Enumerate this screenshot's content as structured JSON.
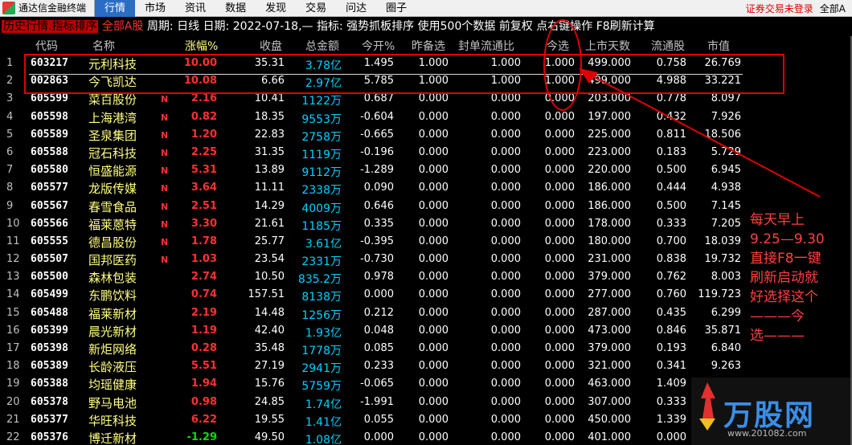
{
  "menubar": {
    "app_title": "通达信金融终端",
    "items": [
      "行情",
      "市场",
      "资讯",
      "数据",
      "发现",
      "交易",
      "问达",
      "圈子"
    ],
    "active": "行情",
    "right": [
      "证券交易未登录",
      "全部A"
    ]
  },
  "infobar": {
    "mode": "历史行情.指标排序",
    "scope": "全部A股",
    "period": "周期: 日线",
    "date": "日期: 2022-07-18,—",
    "indicator": "指标: 强势抓板排序",
    "usage": "使用500个数据",
    "fq": "前复权",
    "tip": "点右键操作",
    "refresh": "F8刷新计算"
  },
  "columns": [
    "代码",
    "名称",
    "涨幅%",
    "收盘",
    "总金额",
    "今开%",
    "昨备选",
    "封单流通比",
    "今选",
    "上市天数",
    "流通股",
    "市值"
  ],
  "rows": [
    {
      "idx": "1",
      "code": "603217",
      "name": "元利科技",
      "flag": "",
      "chg": "10.00",
      "dir": "up",
      "close": "35.31",
      "amt": "3.78亿",
      "open": "1.495",
      "prev": "1.000",
      "seal": "1.000",
      "today": "1.000",
      "days": "499.000",
      "float": "0.758",
      "mv": "26.769"
    },
    {
      "idx": "2",
      "code": "002863",
      "name": "今飞凯达",
      "flag": "",
      "chg": "10.08",
      "dir": "up",
      "close": "6.66",
      "amt": "2.97亿",
      "open": "5.785",
      "prev": "1.000",
      "seal": "1.000",
      "today": "1.000",
      "days": "499.000",
      "float": "4.988",
      "mv": "33.221"
    },
    {
      "idx": "3",
      "code": "605599",
      "name": "菜百股份",
      "flag": "N",
      "chg": "2.16",
      "dir": "up",
      "close": "10.41",
      "amt": "1122万",
      "open": "0.687",
      "prev": "0.000",
      "seal": "0.000",
      "today": "0.000",
      "days": "203.000",
      "float": "0.778",
      "mv": "8.097"
    },
    {
      "idx": "4",
      "code": "605598",
      "name": "上海港湾",
      "flag": "N",
      "chg": "0.82",
      "dir": "up",
      "close": "18.35",
      "amt": "9553万",
      "open": "-0.604",
      "prev": "0.000",
      "seal": "0.000",
      "today": "0.000",
      "days": "197.000",
      "float": "0.432",
      "mv": "7.926"
    },
    {
      "idx": "5",
      "code": "605589",
      "name": "圣泉集团",
      "flag": "N",
      "chg": "1.20",
      "dir": "up",
      "close": "22.83",
      "amt": "2758万",
      "open": "-0.665",
      "prev": "0.000",
      "seal": "0.000",
      "today": "0.000",
      "days": "225.000",
      "float": "0.811",
      "mv": "18.506"
    },
    {
      "idx": "6",
      "code": "605588",
      "name": "冠石科技",
      "flag": "N",
      "chg": "2.25",
      "dir": "up",
      "close": "31.35",
      "amt": "1119万",
      "open": "-0.196",
      "prev": "0.000",
      "seal": "0.000",
      "today": "0.000",
      "days": "223.000",
      "float": "0.183",
      "mv": "5.729"
    },
    {
      "idx": "7",
      "code": "605580",
      "name": "恒盛能源",
      "flag": "N",
      "chg": "5.31",
      "dir": "up",
      "close": "13.89",
      "amt": "9112万",
      "open": "-1.289",
      "prev": "0.000",
      "seal": "0.000",
      "today": "0.000",
      "days": "220.000",
      "float": "0.500",
      "mv": "6.945"
    },
    {
      "idx": "8",
      "code": "605577",
      "name": "龙版传媒",
      "flag": "N",
      "chg": "3.64",
      "dir": "up",
      "close": "11.11",
      "amt": "2338万",
      "open": "0.090",
      "prev": "0.000",
      "seal": "0.000",
      "today": "0.000",
      "days": "186.000",
      "float": "0.444",
      "mv": "4.938"
    },
    {
      "idx": "9",
      "code": "605567",
      "name": "春雪食品",
      "flag": "N",
      "chg": "2.51",
      "dir": "up",
      "close": "14.29",
      "amt": "4009万",
      "open": "0.646",
      "prev": "0.000",
      "seal": "0.000",
      "today": "0.000",
      "days": "186.000",
      "float": "0.500",
      "mv": "7.145"
    },
    {
      "idx": "10",
      "code": "605566",
      "name": "福莱蒽特",
      "flag": "N",
      "chg": "3.30",
      "dir": "up",
      "close": "21.61",
      "amt": "1185万",
      "open": "0.335",
      "prev": "0.000",
      "seal": "0.000",
      "today": "0.000",
      "days": "178.000",
      "float": "0.333",
      "mv": "7.205"
    },
    {
      "idx": "11",
      "code": "605555",
      "name": "德昌股份",
      "flag": "N",
      "chg": "1.78",
      "dir": "up",
      "close": "25.77",
      "amt": "3.61亿",
      "open": "-0.395",
      "prev": "0.000",
      "seal": "0.000",
      "today": "0.000",
      "days": "180.000",
      "float": "0.700",
      "mv": "18.039"
    },
    {
      "idx": "12",
      "code": "605507",
      "name": "国邦医药",
      "flag": "N",
      "chg": "1.03",
      "dir": "up",
      "close": "23.54",
      "amt": "2331万",
      "open": "-0.730",
      "prev": "0.000",
      "seal": "0.000",
      "today": "0.000",
      "days": "231.000",
      "float": "0.838",
      "mv": "19.732"
    },
    {
      "idx": "13",
      "code": "605500",
      "name": "森林包装",
      "flag": "",
      "chg": "2.74",
      "dir": "up",
      "close": "10.50",
      "amt": "835.2万",
      "open": "0.978",
      "prev": "0.000",
      "seal": "0.000",
      "today": "0.000",
      "days": "379.000",
      "float": "0.762",
      "mv": "8.003"
    },
    {
      "idx": "14",
      "code": "605499",
      "name": "东鹏饮料",
      "flag": "",
      "chg": "0.74",
      "dir": "up",
      "close": "157.51",
      "amt": "8138万",
      "open": "0.000",
      "prev": "0.000",
      "seal": "0.000",
      "today": "0.000",
      "days": "277.000",
      "float": "0.760",
      "mv": "119.723"
    },
    {
      "idx": "15",
      "code": "605488",
      "name": "福莱新材",
      "flag": "",
      "chg": "2.19",
      "dir": "up",
      "close": "14.48",
      "amt": "1256万",
      "open": "0.212",
      "prev": "0.000",
      "seal": "0.000",
      "today": "0.000",
      "days": "287.000",
      "float": "0.435",
      "mv": "6.299"
    },
    {
      "idx": "16",
      "code": "605399",
      "name": "晨光新材",
      "flag": "",
      "chg": "1.19",
      "dir": "up",
      "close": "42.40",
      "amt": "1.93亿",
      "open": "0.048",
      "prev": "0.000",
      "seal": "0.000",
      "today": "0.000",
      "days": "473.000",
      "float": "0.846",
      "mv": "35.871"
    },
    {
      "idx": "17",
      "code": "605398",
      "name": "新炬网络",
      "flag": "",
      "chg": "0.28",
      "dir": "up",
      "close": "35.48",
      "amt": "1778万",
      "open": "0.085",
      "prev": "0.000",
      "seal": "0.000",
      "today": "0.000",
      "days": "379.000",
      "float": "0.193",
      "mv": "6.840"
    },
    {
      "idx": "18",
      "code": "605389",
      "name": "长龄液压",
      "flag": "",
      "chg": "5.51",
      "dir": "up",
      "close": "27.19",
      "amt": "2941万",
      "open": "0.233",
      "prev": "0.000",
      "seal": "0.000",
      "today": "0.000",
      "days": "321.000",
      "float": "0.341",
      "mv": "9.263"
    },
    {
      "idx": "19",
      "code": "605388",
      "name": "均瑶健康",
      "flag": "",
      "chg": "1.94",
      "dir": "up",
      "close": "15.76",
      "amt": "5759万",
      "open": "-0.065",
      "prev": "0.000",
      "seal": "0.000",
      "today": "0.000",
      "days": "463.000",
      "float": "1.409",
      "mv": "22.199"
    },
    {
      "idx": "20",
      "code": "605378",
      "name": "野马电池",
      "flag": "",
      "chg": "0.98",
      "dir": "up",
      "close": "24.85",
      "amt": "1.74亿",
      "open": "-1.991",
      "prev": "0.000",
      "seal": "0.000",
      "today": "0.000",
      "days": "307.000",
      "float": "0.333",
      "mv": "8.283"
    },
    {
      "idx": "21",
      "code": "605377",
      "name": "华旺科技",
      "flag": "",
      "chg": "6.22",
      "dir": "up",
      "close": "19.55",
      "amt": "1.41亿",
      "open": "0.055",
      "prev": "0.000",
      "seal": "0.000",
      "today": "0.000",
      "days": "450.000",
      "float": "1.339",
      "mv": "26.193"
    },
    {
      "idx": "22",
      "code": "605376",
      "name": "博迁新材",
      "flag": "",
      "chg": "-1.29",
      "dir": "down",
      "close": "49.50",
      "amt": "1.08亿",
      "open": "0.000",
      "prev": "0.000",
      "seal": "0.000",
      "today": "0.000",
      "days": "401.000",
      "float": "0.000",
      "mv": "0.000"
    }
  ],
  "annotation": {
    "note": [
      "每天早上",
      "9.25—9.30",
      "直接F8一键",
      "刷新启动就",
      "好选择这个",
      "———今",
      "选———"
    ]
  },
  "logo": {
    "text": "万股网",
    "url": "www.201082.com"
  },
  "colors": {
    "up": "#ff3030",
    "down": "#00e000",
    "amount": "#00d0ff",
    "name": "#ffff80",
    "annotation": "#e00000"
  }
}
